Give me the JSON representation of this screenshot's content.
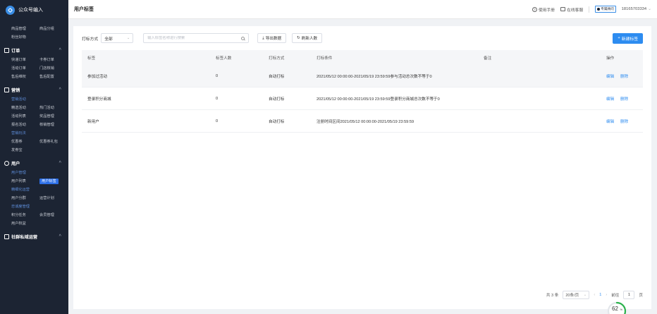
{
  "sidebar": {
    "brand": "公众号编入",
    "goods_items": [
      "商品管理",
      "商品分组",
      "粉丝好物"
    ],
    "order_section": "订单",
    "order_items": [
      "快递订单",
      "卡券订单",
      "活动订单",
      "门店核销",
      "售后维权",
      "售后配置"
    ],
    "marketing_section": "营销",
    "marketing_sub1": "营销活动",
    "marketing_items1": [
      "精选活动",
      "热门活动",
      "活动列表",
      "奖品管理",
      "报名活动",
      "核销管理"
    ],
    "marketing_sub2": "营销玩法",
    "marketing_items2": [
      "优惠券",
      "优惠券礼包",
      "发券宝"
    ],
    "user_section": "用户",
    "user_sub1": "用户管理",
    "user_items1": [
      "用户列表",
      "用户标签"
    ],
    "user_sub2": "精细化运营",
    "user_items2": [
      "用户分群",
      "运营计划"
    ],
    "user_sub3": "忠诚度管理",
    "user_items3": [
      "积分任务",
      "会员管理",
      "用户权益"
    ],
    "community_section": "社群私域运营"
  },
  "header": {
    "title": "用户标签",
    "manual": "使用手册",
    "support": "在线客服",
    "exclusive": "专属顾问",
    "phone": "18165703334"
  },
  "toolbar": {
    "method_label": "打标方式",
    "method_value": "全部",
    "search_placeholder": "输入标签名称进行搜索",
    "export_label": "导出数据",
    "refresh_label": "刷新人数",
    "create_label": "新建标签"
  },
  "table": {
    "headers": [
      "标签",
      "标签人数",
      "打标方式",
      "打标条件",
      "备注",
      "操作"
    ],
    "rows": [
      {
        "tag": "参加过活动",
        "count": "0",
        "method": "自动打标",
        "condition": "2021/05/12 00:00:00-2021/05/19 23:59:59参与活动总次数不等于0",
        "note": "",
        "edit": "编辑",
        "delete": "删除"
      },
      {
        "tag": "登录积分商城",
        "count": "0",
        "method": "自动打标",
        "condition": "2021/05/12 00:00:00-2021/05/19 23:59:59登录积分商城总次数不等于0",
        "note": "",
        "edit": "编辑",
        "delete": "删除"
      },
      {
        "tag": "新用户",
        "count": "0",
        "method": "自动打标",
        "condition": "注册时间区间2021/05/12 00:00:00-2021/05/19 23:59:59",
        "note": "",
        "edit": "编辑",
        "delete": "删除"
      }
    ]
  },
  "pager": {
    "total": "共 3 条",
    "page_size": "20条/页",
    "current": "1",
    "goto_label": "前往",
    "goto_value": "1",
    "page_unit": "页"
  },
  "progress": {
    "value": "62",
    "unit": "%",
    "fraction": 0.62,
    "color": "#2bb24c"
  }
}
